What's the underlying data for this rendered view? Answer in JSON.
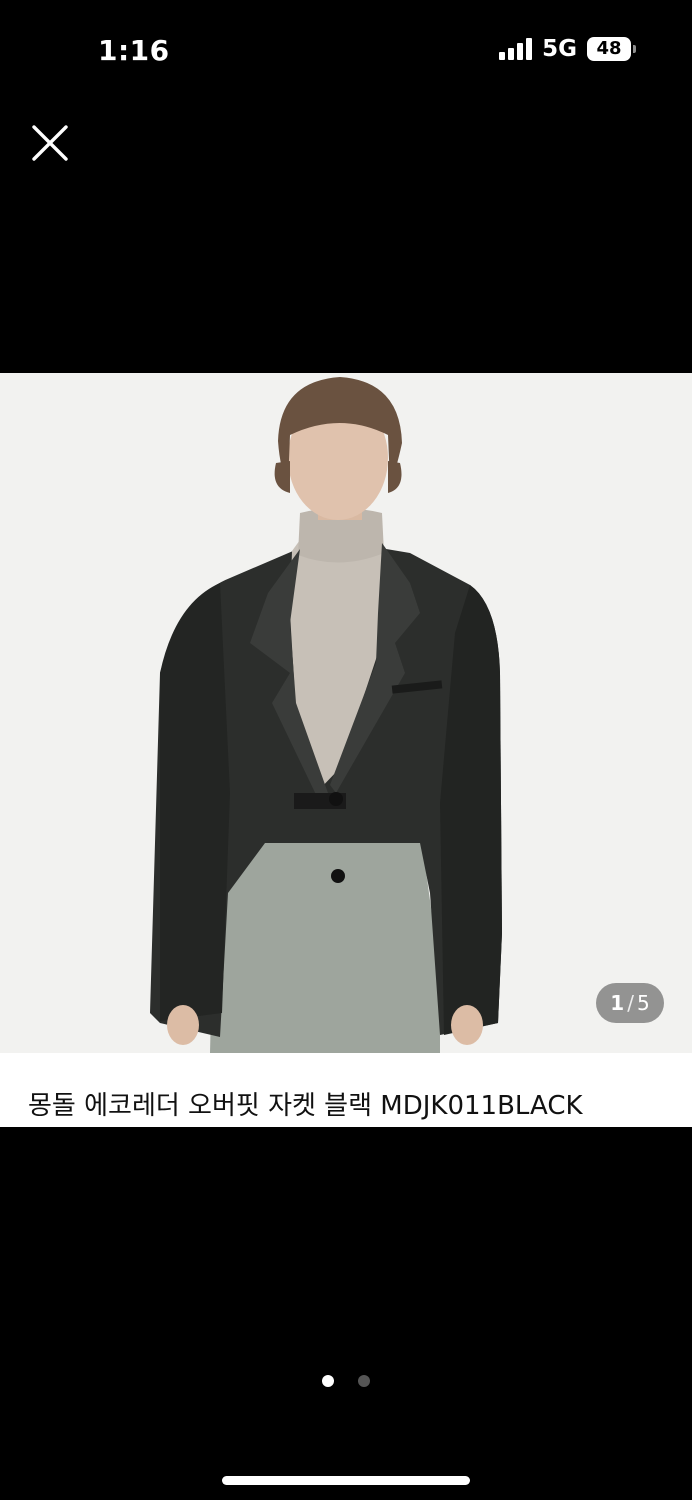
{
  "status_bar": {
    "time": "1:16",
    "network": "5G",
    "battery": "48"
  },
  "icons": {
    "close": "close-icon"
  },
  "product": {
    "title": "몽돌 에코레더 오버핏 자켓 블랙 MDJK011BLACK",
    "image_index": "1",
    "image_separator": "/",
    "image_total": "5"
  },
  "pager": {
    "pages": 2,
    "active_page": 1
  },
  "colors": {
    "background": "#000000",
    "photo_background": "#f2f2f0",
    "counter_badge": "#6e6e6e"
  }
}
